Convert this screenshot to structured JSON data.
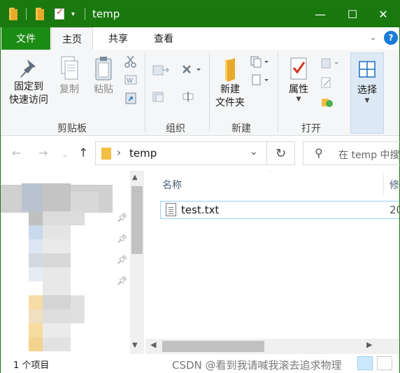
{
  "window": {
    "title": "temp",
    "controls": {
      "minimize": "—",
      "maximize": "☐",
      "close": "✕"
    }
  },
  "ribbon_tabs": [
    "文件",
    "主页",
    "共享",
    "查看"
  ],
  "help_label": "?",
  "ribbon": {
    "clipboard": {
      "pin_label_1": "固定到",
      "pin_label_2": "快速访问",
      "copy": "复制",
      "paste": "粘贴",
      "group": "剪贴板"
    },
    "organize": {
      "group": "组织"
    },
    "new": {
      "new_folder_1": "新建",
      "new_folder_2": "文件夹",
      "group": "新建"
    },
    "open": {
      "properties": "属性",
      "group": "打开"
    },
    "select": {
      "label": "选择"
    }
  },
  "address": {
    "path": "temp",
    "breadcrumb_sep": "›",
    "search_placeholder": "在 temp 中搜"
  },
  "columns": {
    "name": "名称",
    "modified": "修"
  },
  "files": [
    {
      "name": "test.txt",
      "date_fragment": "20"
    }
  ],
  "status": {
    "item_count": "1 个项目"
  },
  "watermark": "CSDN @看到我请喊我滚去追求物理",
  "colors": {
    "titlebar": "#19790f",
    "file_tab": "#1b8c14",
    "selection_border": "#99d1ff",
    "folder": "#f4c24a"
  },
  "icons": {
    "pin": "pin-icon",
    "copy": "copy-icon",
    "paste": "paste-icon",
    "cut": "scissors-icon",
    "delete": "delete-icon",
    "rename": "rename-icon",
    "new_folder": "new-folder-icon",
    "properties": "properties-icon",
    "select": "select-grid-icon",
    "search": "search-icon",
    "refresh": "refresh-icon"
  }
}
